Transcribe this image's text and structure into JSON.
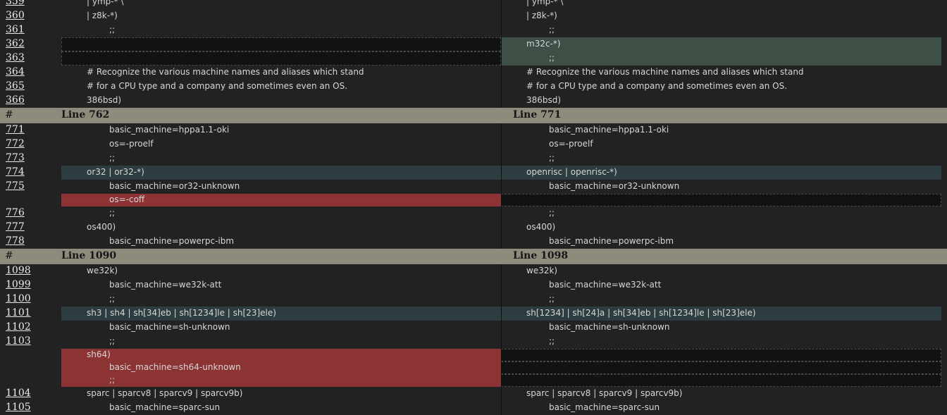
{
  "diff": {
    "rows": [
      {
        "type": "line",
        "n": "359",
        "left": {
          "text": "| ymp-* \\",
          "indent": 1
        },
        "right": {
          "text": "| ymp-* \\",
          "indent": 1
        }
      },
      {
        "type": "line",
        "n": "360",
        "left": {
          "text": "| z8k-*)",
          "indent": 1
        },
        "right": {
          "text": "| z8k-*)",
          "indent": 1
        }
      },
      {
        "type": "line",
        "n": "361",
        "left": {
          "text": ";;",
          "indent": 2
        },
        "right": {
          "text": ";;",
          "indent": 2
        }
      },
      {
        "type": "line",
        "n": "362",
        "left": {
          "kind": "empty"
        },
        "right": {
          "text": "m32c-*)",
          "indent": 1,
          "kind": "add"
        }
      },
      {
        "type": "line",
        "n": "363",
        "left": {
          "kind": "empty"
        },
        "right": {
          "text": ";;",
          "indent": 2,
          "kind": "add"
        }
      },
      {
        "type": "line",
        "n": "364",
        "left": {
          "text": "# Recognize the various machine names and aliases which stand",
          "indent": 1
        },
        "right": {
          "text": "# Recognize the various machine names and aliases which stand",
          "indent": 1
        }
      },
      {
        "type": "line",
        "n": "365",
        "left": {
          "text": "# for a CPU type and a company and sometimes even an OS.",
          "indent": 1
        },
        "right": {
          "text": "# for a CPU type and a company and sometimes even an OS.",
          "indent": 1
        }
      },
      {
        "type": "line",
        "n": "366",
        "left": {
          "text": "386bsd)",
          "indent": 1
        },
        "right": {
          "text": "386bsd)",
          "indent": 1
        }
      },
      {
        "type": "header",
        "hash": "#",
        "left": "Line 762",
        "right": "Line 771"
      },
      {
        "type": "line",
        "n": "771",
        "left": {
          "text": "basic_machine=hppa1.1-oki",
          "indent": 2
        },
        "right": {
          "text": "basic_machine=hppa1.1-oki",
          "indent": 2
        }
      },
      {
        "type": "line",
        "n": "772",
        "left": {
          "text": "os=-proelf",
          "indent": 2
        },
        "right": {
          "text": "os=-proelf",
          "indent": 2
        }
      },
      {
        "type": "line",
        "n": "773",
        "left": {
          "text": ";;",
          "indent": 2
        },
        "right": {
          "text": ";;",
          "indent": 2
        }
      },
      {
        "type": "line",
        "n": "774",
        "left": {
          "text": "or32 | or32-*)",
          "indent": 1,
          "kind": "chg"
        },
        "right": {
          "text": "openrisc | openrisc-*)",
          "indent": 1,
          "kind": "chg"
        }
      },
      {
        "type": "line",
        "n": "775",
        "left": {
          "text": "basic_machine=or32-unknown",
          "indent": 2
        },
        "right": {
          "text": "basic_machine=or32-unknown",
          "indent": 2
        }
      },
      {
        "type": "line",
        "n": "",
        "left": {
          "text": "os=-coff",
          "indent": 2,
          "kind": "del"
        },
        "right": {
          "kind": "empty"
        }
      },
      {
        "type": "line",
        "n": "776",
        "left": {
          "text": ";;",
          "indent": 2
        },
        "right": {
          "text": ";;",
          "indent": 2
        }
      },
      {
        "type": "line",
        "n": "777",
        "left": {
          "text": "os400)",
          "indent": 1
        },
        "right": {
          "text": "os400)",
          "indent": 1
        }
      },
      {
        "type": "line",
        "n": "778",
        "left": {
          "text": "basic_machine=powerpc-ibm",
          "indent": 2
        },
        "right": {
          "text": "basic_machine=powerpc-ibm",
          "indent": 2
        }
      },
      {
        "type": "header",
        "hash": "#",
        "left": "Line 1090",
        "right": "Line 1098"
      },
      {
        "type": "line",
        "n": "1098",
        "left": {
          "text": "we32k)",
          "indent": 1
        },
        "right": {
          "text": "we32k)",
          "indent": 1
        }
      },
      {
        "type": "line",
        "n": "1099",
        "left": {
          "text": "basic_machine=we32k-att",
          "indent": 2
        },
        "right": {
          "text": "basic_machine=we32k-att",
          "indent": 2
        }
      },
      {
        "type": "line",
        "n": "1100",
        "left": {
          "text": ";;",
          "indent": 2
        },
        "right": {
          "text": ";;",
          "indent": 2
        }
      },
      {
        "type": "line",
        "n": "1101",
        "left": {
          "text": "sh3 | sh4 | sh[34]eb | sh[1234]le | sh[23]ele)",
          "indent": 1,
          "kind": "chg"
        },
        "right": {
          "text": "sh[1234] | sh[24]a | sh[34]eb | sh[1234]le | sh[23]ele)",
          "indent": 1,
          "kind": "chg"
        }
      },
      {
        "type": "line",
        "n": "1102",
        "left": {
          "text": "basic_machine=sh-unknown",
          "indent": 2
        },
        "right": {
          "text": "basic_machine=sh-unknown",
          "indent": 2
        }
      },
      {
        "type": "line",
        "n": "1103",
        "left": {
          "text": ";;",
          "indent": 2
        },
        "right": {
          "text": ";;",
          "indent": 2
        }
      },
      {
        "type": "line",
        "n": "",
        "left": {
          "text": "sh64)",
          "indent": 1,
          "kind": "del"
        },
        "right": {
          "kind": "empty"
        }
      },
      {
        "type": "line",
        "n": "",
        "left": {
          "text": "basic_machine=sh64-unknown",
          "indent": 2,
          "kind": "del"
        },
        "right": {
          "kind": "empty"
        }
      },
      {
        "type": "line",
        "n": "",
        "left": {
          "text": ";;",
          "indent": 2,
          "kind": "del"
        },
        "right": {
          "kind": "empty"
        }
      },
      {
        "type": "line",
        "n": "1104",
        "left": {
          "text": "sparc | sparcv8 | sparcv9 | sparcv9b)",
          "indent": 1
        },
        "right": {
          "text": "sparc | sparcv8 | sparcv9 | sparcv9b)",
          "indent": 1
        }
      },
      {
        "type": "line",
        "n": "1105",
        "left": {
          "text": "basic_machine=sparc-sun",
          "indent": 2
        },
        "right": {
          "text": "basic_machine=sparc-sun",
          "indent": 2
        }
      }
    ]
  },
  "colors": {
    "background": "#222222",
    "added": "#3e4f45",
    "changed": "#2d3c3f",
    "deleted": "#8c3434",
    "empty": "#121212",
    "header": "#8e8b7d"
  }
}
